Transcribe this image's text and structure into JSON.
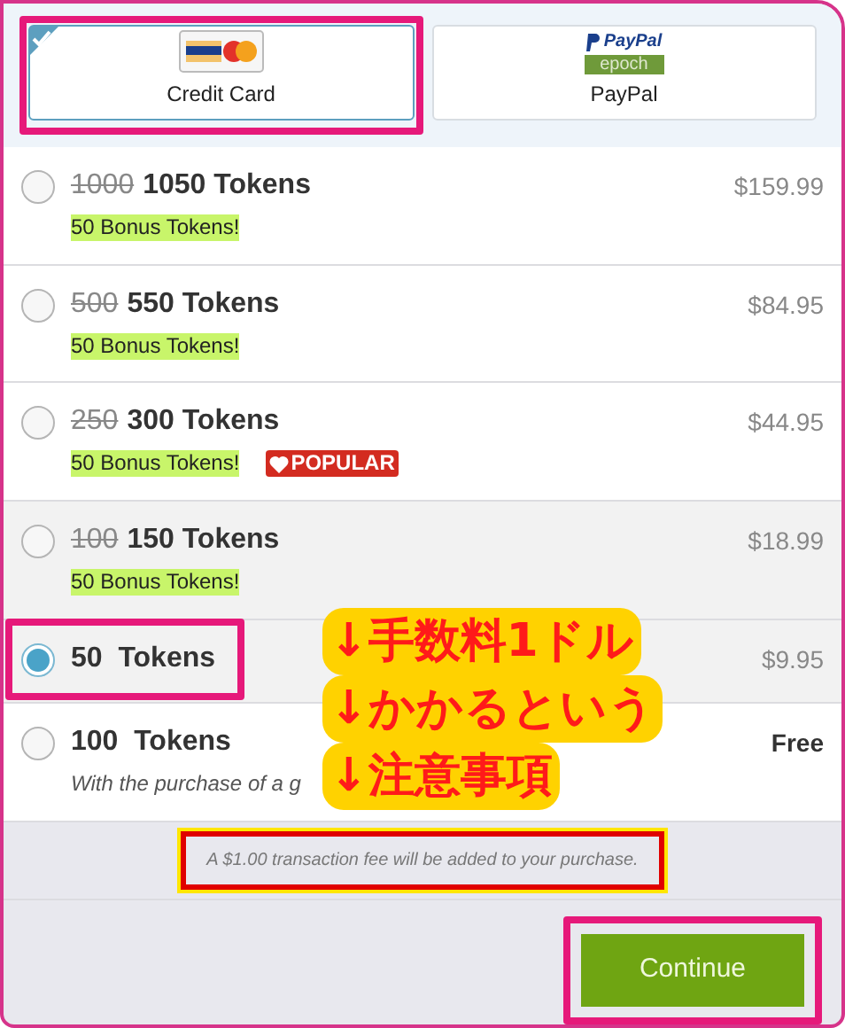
{
  "payment_methods": [
    {
      "label": "Credit Card",
      "selected": true,
      "kind": "card"
    },
    {
      "label": "PayPal",
      "selected": false,
      "kind": "wallet",
      "logo_texts": [
        "PayPal",
        "epoch"
      ]
    }
  ],
  "packages": [
    {
      "kind": "offer",
      "old_amount": "1000",
      "amount": "1050 Tokens",
      "bonus": "50 Bonus Tokens!",
      "price": "$159.99",
      "selected": false,
      "highlighted": false
    },
    {
      "kind": "offer",
      "old_amount": "500",
      "amount": "550 Tokens",
      "bonus": "50 Bonus Tokens!",
      "price": "$84.95",
      "selected": false,
      "highlighted": false
    },
    {
      "kind": "offer",
      "old_amount": "250",
      "amount": "300 Tokens",
      "bonus": "50 Bonus Tokens!",
      "badge": "POPULAR",
      "price": "$44.95",
      "selected": false,
      "highlighted": false
    },
    {
      "kind": "offer",
      "old_amount": "100",
      "amount": "150 Tokens",
      "bonus": "50 Bonus Tokens!",
      "price": "$18.99",
      "selected": false,
      "highlighted": true
    },
    {
      "kind": "plain",
      "amount": "50  Tokens",
      "price": "$9.95",
      "selected": true,
      "highlighted": true
    },
    {
      "kind": "free",
      "amount": "100  Tokens",
      "note": "With the purchase of a g",
      "price": "Free",
      "selected": false,
      "highlighted": false
    }
  ],
  "fee_notice": "A $1.00 transaction fee will be added to your purchase.",
  "continue_button": "Continue",
  "annotation": {
    "lines": [
      "↓手数料1ドル",
      "↓かかるという",
      "↓注意事項"
    ]
  }
}
